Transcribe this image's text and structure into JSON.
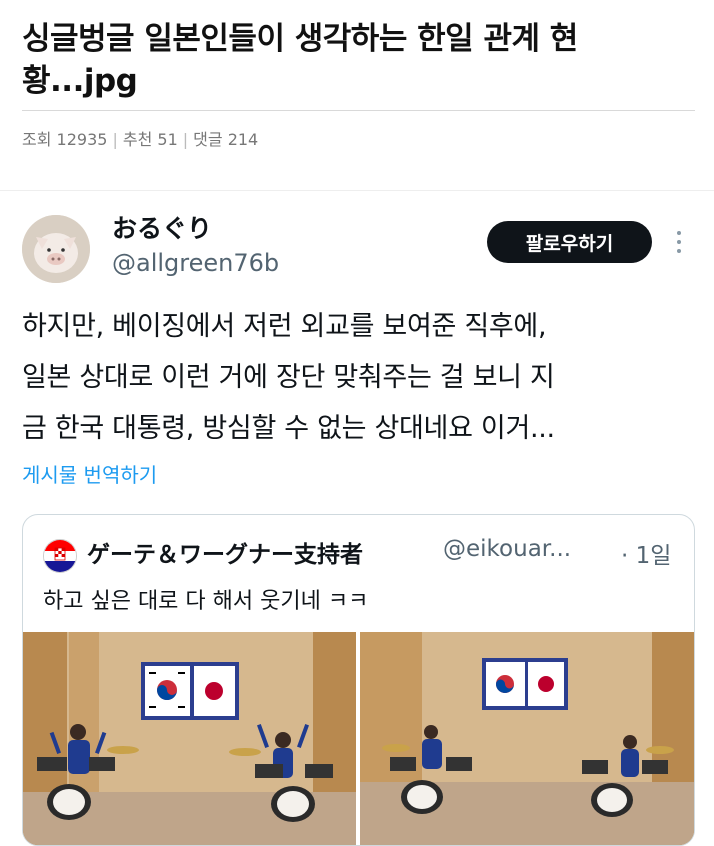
{
  "post": {
    "title": "싱글벙글 일본인들이 생각하는 한일 관계 현황...jpg",
    "views_label": "조회",
    "views": "12935",
    "likes_label": "추천",
    "likes": "51",
    "comments_label": "댓글",
    "comments": "214"
  },
  "tweet": {
    "display_name": "おるぐり",
    "handle": "@allgreen76b",
    "follow_label": "팔로우하기",
    "text_lines": [
      "하지만, 베이징에서 저런 외교를 보여준 직후에,",
      "일본 상대로 이런 거에 장단 맞춰주는 걸 보니 지",
      "금 한국 대통령, 방심할 수 없는 상대네요 이거..."
    ],
    "translate_label": "게시물 번역하기"
  },
  "quote": {
    "display_name": "ゲーテ＆ワーグナー支持者",
    "handle": "@eikouar...",
    "time": "· 1일",
    "text": "하고 싶은 대로 다 해서 웃기네 ㅋㅋ"
  },
  "icons": {
    "avatar": "pig-avatar",
    "quote_avatar": "croatia-flag-icon",
    "more": "more-vertical-icon"
  },
  "colors": {
    "link": "#1d9bf0",
    "follow_bg": "#0f1419",
    "muted": "#536471"
  }
}
